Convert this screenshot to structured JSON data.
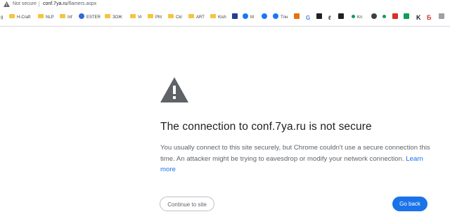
{
  "address_bar": {
    "security_status": "Not secure",
    "url_host": "conf.7ya.ru",
    "url_path": "/flamers.aspx"
  },
  "bookmarks": [
    {
      "label": "g",
      "icon": "folder-icon"
    },
    {
      "label": "H-Craft",
      "icon": "folder-icon"
    },
    {
      "label": "NLP",
      "icon": "folder-icon"
    },
    {
      "label": "Inf",
      "icon": "folder-icon"
    },
    {
      "label": "ESTER",
      "icon": "globe-icon"
    },
    {
      "label": "ЗОЖ",
      "icon": "folder-icon"
    },
    {
      "label": "Vr",
      "icon": "folder-icon"
    },
    {
      "label": "Pht",
      "icon": "folder-icon"
    },
    {
      "label": "Ckl",
      "icon": "folder-icon"
    },
    {
      "label": "ART",
      "icon": "folder-icon"
    },
    {
      "label": "Kish",
      "icon": "folder-icon"
    },
    {
      "label": "M",
      "icon": "facebook-icon"
    },
    {
      "label": "Тлн",
      "icon": "facebook-icon"
    },
    {
      "label": "Кл",
      "icon": "green-dot-icon"
    }
  ],
  "interstitial": {
    "title": "The connection to conf.7ya.ru is not secure",
    "body": "You usually connect to this site securely, but Chrome couldn't use a secure connection this time. An attacker might be trying to eavesdrop or modify your network connection.",
    "learn_more": "Learn more",
    "continue_label": "Continue to site",
    "back_label": "Go back"
  },
  "colors": {
    "accent": "#1a73e8",
    "text_primary": "#202124",
    "text_secondary": "#5f6368",
    "warning_icon": "#5f6368"
  }
}
